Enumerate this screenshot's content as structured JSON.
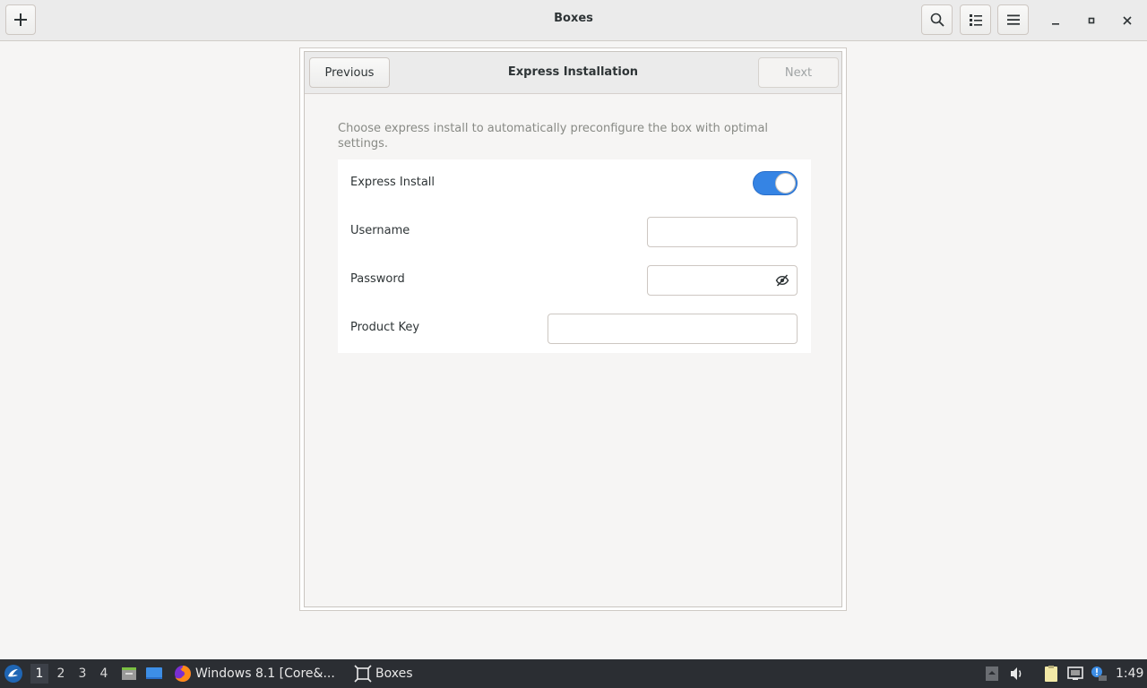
{
  "app": {
    "title": "Boxes"
  },
  "headerbar": {
    "new_icon": "plus-icon",
    "search_icon": "search-icon",
    "view_icon": "list-view-icon",
    "menu_icon": "hamburger-menu-icon"
  },
  "dialog": {
    "title": "Express Installation",
    "previous_label": "Previous",
    "next_label": "Next",
    "description": "Choose express install to automatically preconfigure the box with optimal settings.",
    "express_install": {
      "label": "Express Install",
      "enabled": true
    },
    "username": {
      "label": "Username",
      "value": ""
    },
    "password": {
      "label": "Password",
      "value": ""
    },
    "product_key": {
      "label": "Product Key",
      "value": ""
    }
  },
  "taskbar": {
    "workspaces": [
      "1",
      "2",
      "3",
      "4"
    ],
    "active_workspace": "1",
    "tasks": [
      {
        "label": "Windows 8.1 [Core&...",
        "icon": "firefox-icon"
      },
      {
        "label": "Boxes",
        "icon": "boxes-icon"
      }
    ],
    "clock": "1:49"
  },
  "colors": {
    "accent": "#3584e4",
    "taskbar": "#2b2e33"
  }
}
